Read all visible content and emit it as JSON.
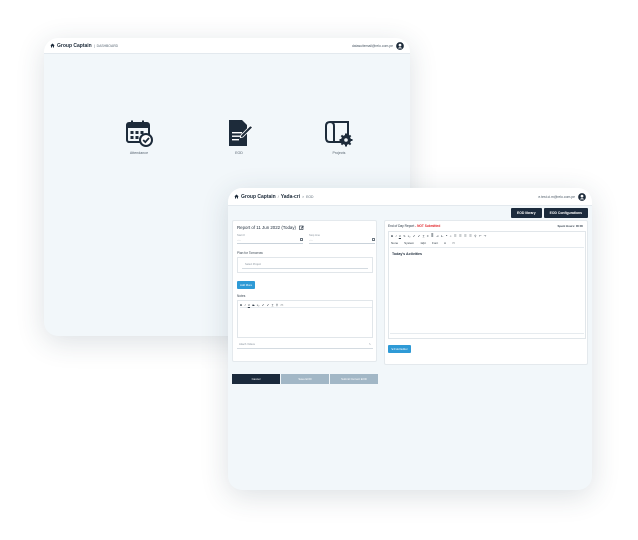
{
  "window_a": {
    "brand": "Group Captain",
    "section": "DASHBOARD",
    "account": "datasuitemail@relo.com.pe",
    "tiles": [
      {
        "label": "Attendance",
        "icon": "calendar-check-icon"
      },
      {
        "label": "EOD",
        "icon": "document-edit-icon"
      },
      {
        "label": "Projects",
        "icon": "blueprint-gear-icon"
      }
    ]
  },
  "window_b": {
    "brand": "Group Captain",
    "crumb": "Yada-cri",
    "crumb2": "EOD",
    "account": "e.test.ci.m@relo.com.pe",
    "buttons": {
      "eod_library": "EOD library",
      "eod_configuration": "EOD Configurations"
    },
    "report_title": "Report of 11 Jun 2022 (Today)",
    "fields": [
      {
        "label": "Start #",
        "placeholder": "--:--"
      },
      {
        "label": "Stop time",
        "placeholder": "--:--"
      }
    ],
    "plan_heading": "Plan for Tomorrow",
    "plan_placeholder": "Select Project",
    "add_more": "Add More",
    "notes_heading": "Notes",
    "attach_placeholder": "Attach Videos",
    "eod_heading": "End of Day Report",
    "eod_status": "NOT Submitted",
    "spent_hours": "Spent Hours: 00:00",
    "activities_heading": "Today's Activities",
    "fold_editor": "Fold Editor",
    "actions": {
      "cancel": "Cancel",
      "save": "Save EOD",
      "submit": "Submit Current EOD"
    },
    "editor_dropdowns": [
      "None",
      "System",
      "12pt",
      "Font"
    ],
    "colors": {
      "navy": "#1b2a3c",
      "blue": "#2e9ad6",
      "alert": "#e2262b",
      "muted": "#a2b7c6"
    }
  }
}
